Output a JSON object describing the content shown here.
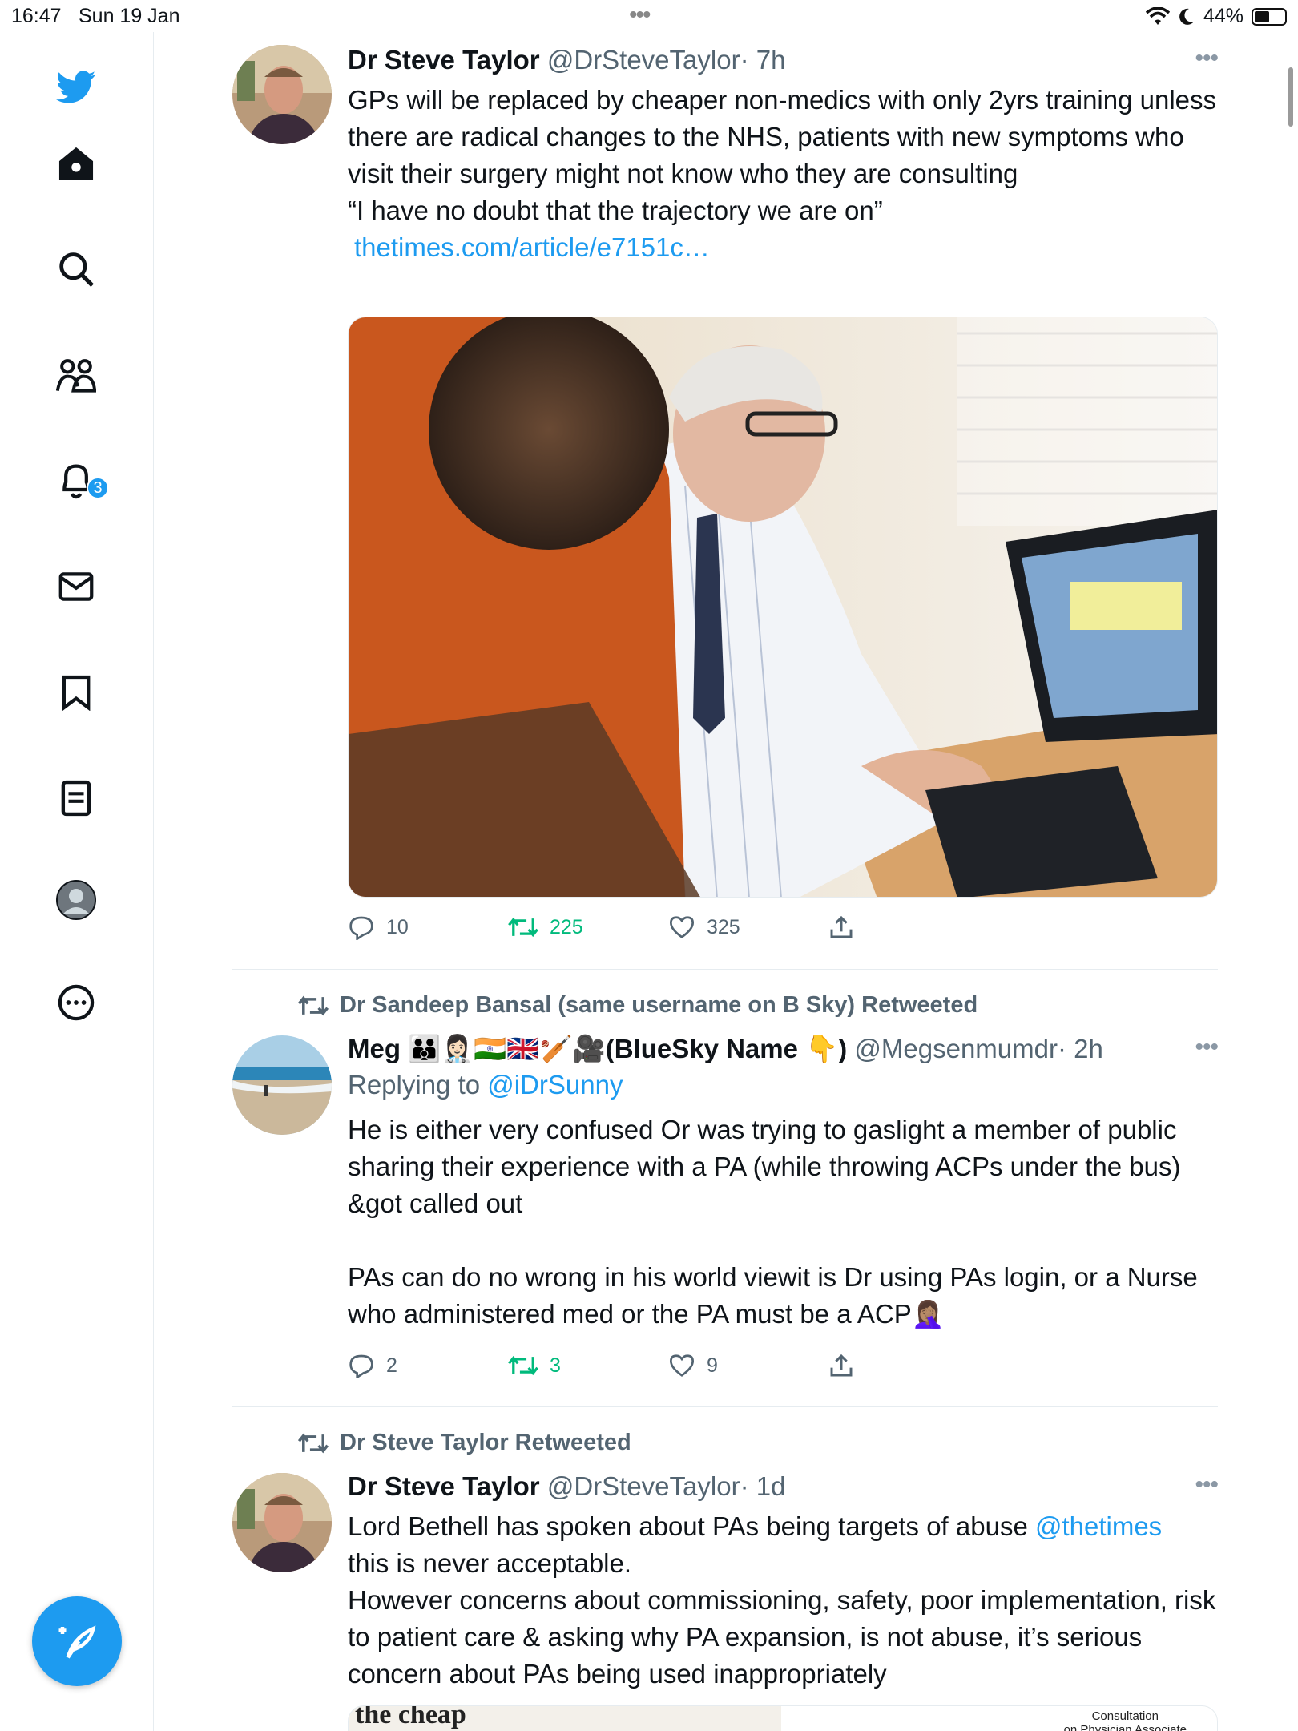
{
  "status_bar": {
    "time": "16:47",
    "date": "Sun 19 Jan",
    "battery": "44%"
  },
  "sidebar": {
    "items": [
      "twitter-logo",
      "home",
      "search",
      "communities",
      "notifications",
      "messages",
      "bookmarks",
      "lists",
      "profile",
      "more"
    ],
    "notification_count": "3"
  },
  "tweets": [
    {
      "name": "Dr Steve Taylor",
      "handle": "@DrSteveTaylor",
      "time": "· 7h",
      "text": "GPs will be replaced by cheaper non-medics with only 2yrs training unless there are radical changes to the NHS, patients with new symptoms who visit their surgery might not know who they are consulting\n“I have no doubt that the trajectory we are on”",
      "link": "thetimes.com/article/e7151c…",
      "replies": "10",
      "retweets": "225",
      "likes": "325"
    },
    {
      "retweeted_by": "Dr Sandeep Bansal (same username on B Sky) Retweeted",
      "name": "Meg 👪👩🏻‍⚕️🇮🇳🇬🇧🏏🎥(BlueSky Name 👇)",
      "handle": "@Megsenmumdr",
      "time": "· 2h",
      "replying_prefix": "Replying to ",
      "replying_to": "@iDrSunny",
      "text": "He is either very confused Or was trying to gaslight a member of public sharing their experience with a PA (while throwing ACPs under the bus) &got called out\n\nPAs can do no wrong in his world viewit is Dr using PAs login, or a Nurse who administered med or the PA must be a ACP🤦🏽‍♀️",
      "replies": "2",
      "retweets": "3",
      "likes": "9"
    },
    {
      "retweeted_by": "Dr Steve Taylor Retweeted",
      "name": "Dr Steve Taylor",
      "handle": "@DrSteveTaylor",
      "time": "· 1d",
      "text_before": "Lord Bethell has spoken about PAs being targets of abuse ",
      "mention": "@thetimes",
      "text_after": "\nthis is never acceptable.\nHowever concerns about commissioning, safety, poor implementation, risk to patient care & asking why PA expansion, is not abuse, it’s serious concern about PAs being used inappropriately",
      "preview_left": "the cheap",
      "preview_right": "Consultation\non Physician Associate"
    }
  ],
  "more_label": "•••"
}
